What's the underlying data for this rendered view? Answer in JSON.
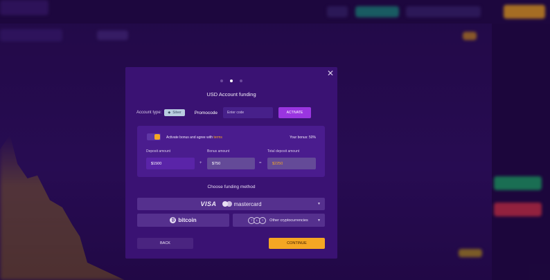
{
  "modal": {
    "title": "USD Account funding",
    "close_icon": "close-icon",
    "step_current": 2,
    "step_total": 3
  },
  "account": {
    "type_label": "Account type:",
    "type_value": "Silver"
  },
  "promocode": {
    "label": "Promocode",
    "placeholder": "Enter code",
    "value": "",
    "activate_label": "ACTIVATE"
  },
  "bonus": {
    "toggle_on": true,
    "agree_text": "Activate bonus and agree with",
    "terms_label": "terms",
    "your_bonus": "Your bonus: 50%"
  },
  "fields": {
    "deposit_label": "Deposit amount",
    "deposit_value": "$1500",
    "bonus_label": "Bonus amount",
    "bonus_value": "$750",
    "total_label": "Total deposit amount",
    "total_value": "$2250",
    "plus": "+",
    "equals": "="
  },
  "funding": {
    "heading": "Choose funding method",
    "visa": "VISA",
    "mastercard": "mastercard",
    "bitcoin": "bitcoin",
    "other_crypto": "Other cryptocurrencies"
  },
  "actions": {
    "back": "BACK",
    "continue": "CONTINUE"
  },
  "colors": {
    "accent": "#f5a623",
    "purple": "#9a35e0",
    "modal_bg": "#3a1273"
  }
}
